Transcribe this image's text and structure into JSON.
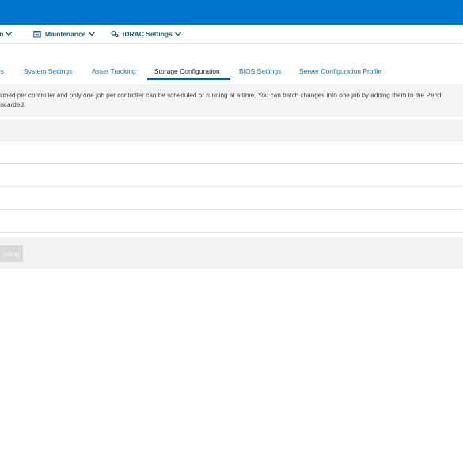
{
  "colors": {
    "topbar": "#0076ce",
    "nav_text": "#0e5a96",
    "tab_link": "#1a73b9",
    "active_underline": "#0e5a96"
  },
  "nav": {
    "configuration": {
      "label": "on",
      "icon": "chevron-down-icon"
    },
    "maintenance": {
      "label": "Maintenance",
      "icon": "calendar-icon"
    },
    "idrac_settings": {
      "label": "iDRAC Settings",
      "icon": "gears-icon"
    }
  },
  "tabs": [
    {
      "label": "es",
      "active": false
    },
    {
      "label": "System Settings",
      "active": false
    },
    {
      "label": "Asset Tracking",
      "active": false
    },
    {
      "label": "Storage Configuration",
      "active": true
    },
    {
      "label": "BIOS Settings",
      "active": false
    },
    {
      "label": "Server Configuration Profile",
      "active": false
    }
  ],
  "info": {
    "line1": "irmed per controller and only one job per controller can be scheduled or running at a time. You can batch changes into one job by adding them to the Pend",
    "line2": "iscarded."
  },
  "footer": {
    "button_label": "nding"
  }
}
